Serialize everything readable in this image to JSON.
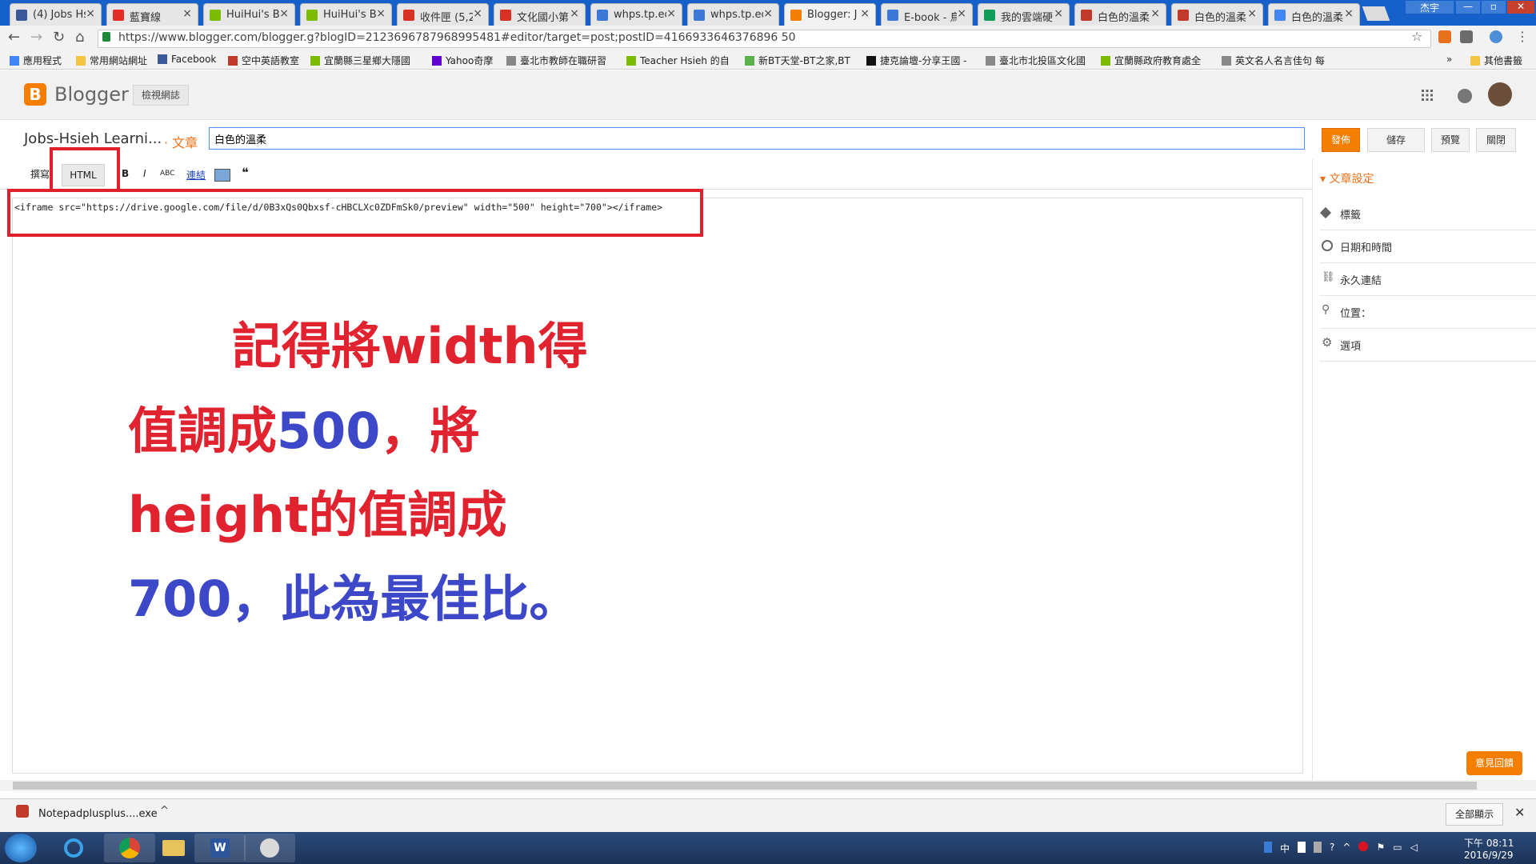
{
  "browser": {
    "tabs": [
      {
        "title": "(4) Jobs Hs",
        "color": "#3b5998"
      },
      {
        "title": "藍寶線",
        "color": "#e52d27"
      },
      {
        "title": "HuiHui's Bl",
        "color": "#7cbb00"
      },
      {
        "title": "HuiHui's Bl",
        "color": "#7cbb00"
      },
      {
        "title": "收件匣 (5,2",
        "color": "#d93025"
      },
      {
        "title": "文化國小第",
        "color": "#d93025"
      },
      {
        "title": "whps.tp.ed",
        "color": "#3c78d8"
      },
      {
        "title": "whps.tp.ed",
        "color": "#3c78d8"
      },
      {
        "title": "Blogger: J",
        "color": "#f57d00"
      },
      {
        "title": "E-book - 鳥",
        "color": "#3c78d8"
      },
      {
        "title": "我的雲端硬",
        "color": "#0f9d58"
      },
      {
        "title": "白色的溫柔",
        "color": "#c0392b"
      },
      {
        "title": "白色的溫柔",
        "color": "#c0392b"
      },
      {
        "title": "白色的溫柔",
        "color": "#4285f4"
      }
    ],
    "window_user": "杰宇",
    "url": "https://www.blogger.com/blogger.g?blogID=2123696787968995481#editor/target=post;postID=4166933646376896 50",
    "bookmarks": [
      "應用程式",
      "常用網站網址",
      "Facebook",
      "空中英語教室",
      "宜蘭縣三星鄉大隱國",
      "Yahoo奇摩",
      "臺北市教師在職研習",
      "Teacher Hsieh 的自",
      "新BT天堂-BT之家,BT",
      "捷克論壇-分享王國 -",
      "臺北市北投區文化國",
      "宜蘭縣政府教育處全",
      "英文名人名言佳句 每",
      "其他書籤"
    ]
  },
  "blogger": {
    "app_name": "Blogger",
    "view_site": "檢視網誌",
    "blog_title": "Jobs-Hsieh Learni...",
    "post_word": "· 文章",
    "post_title": "白色的溫柔",
    "buttons": {
      "publish": "發佈",
      "save": "儲存",
      "preview": "預覽",
      "close": "關閉"
    },
    "modes": {
      "compose": "撰寫",
      "html": "HTML"
    },
    "tools": {
      "bold": "B",
      "italic": "I",
      "abc": "ABC",
      "link": "連結",
      "quote": "❝"
    },
    "code": "<iframe src=\"https://drive.google.com/file/d/0B3xQs0Qbxsf-cHBCLXc0ZDFmSk0/preview\" width=\"500\" height=\"700\"></iframe>",
    "annotation": {
      "l1": "記得將width得",
      "l2a": "值調成",
      "l2b": "500",
      "l2c": "，將",
      "l3": "height的值調成",
      "l4": "700，此為最佳比。"
    },
    "side": {
      "header": "文章設定",
      "items": [
        "標籤",
        "日期和時間",
        "永久連結",
        "位置：",
        "選項"
      ]
    },
    "feedback": "意見回饋"
  },
  "download_bar": {
    "file": "Notepadplusplus....exe",
    "show_all": "全部顯示"
  },
  "taskbar": {
    "time": "下午 08:11",
    "date": "2016/9/29"
  }
}
